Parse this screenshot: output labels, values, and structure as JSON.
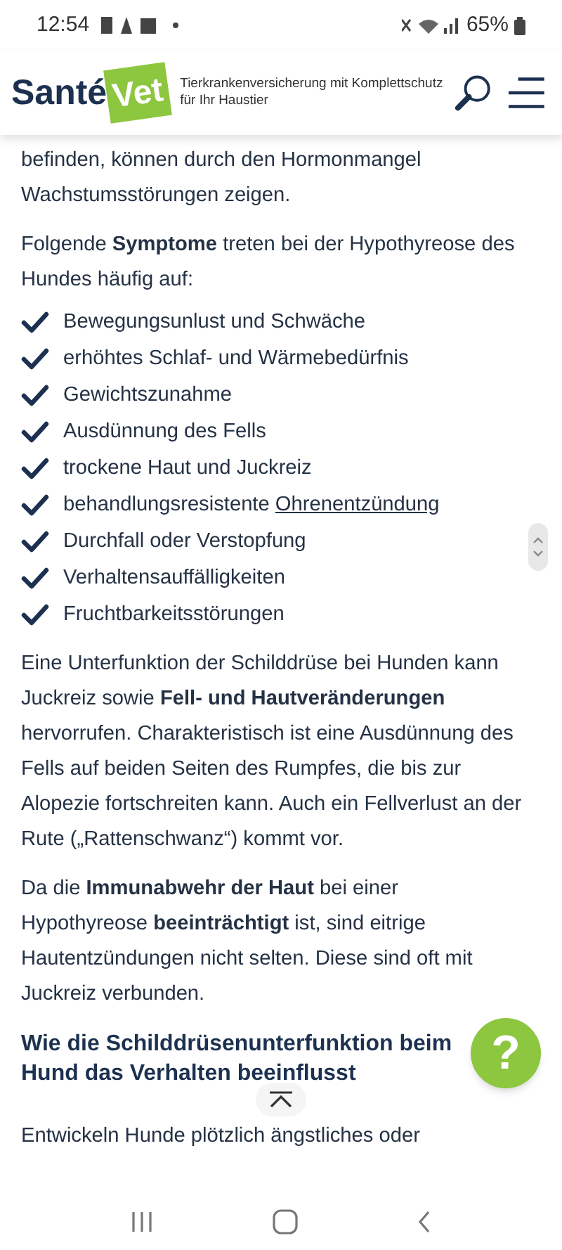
{
  "status_bar": {
    "time": "12:54",
    "battery": "65%"
  },
  "header": {
    "logo_left": "Santé",
    "logo_right": "Vet",
    "tagline": "Tierkrankenversicherung mit Komplettschutz für Ihr Haustier"
  },
  "intro": "befinden, können durch den Hormonmangel Wachstumsstörungen zeigen.",
  "symptoms_intro": "Folgende **Symptome** treten bei der Hypothyreose des Hundes häufig auf:",
  "symptoms": [
    {
      "text": "Bewegungsunlust und Schwäche"
    },
    {
      "text": "erhöhtes Schlaf- und Wärmebedürfnis"
    },
    {
      "text": "Gewichtszunahme"
    },
    {
      "text": "Ausdünnung des Fells"
    },
    {
      "text": "trockene Haut und Juckreiz"
    },
    {
      "text": "behandlungsresistente ",
      "link": "Ohrenentzündung"
    },
    {
      "text": "Durchfall oder Verstopfung"
    },
    {
      "text": "Verhaltensauffälligkeiten"
    },
    {
      "text": "Fruchtbarkeitsstörungen"
    }
  ],
  "paragraphs": [
    "Eine Unterfunktion der Schilddrüse bei Hunden kann Juckreiz sowie **Fell- und Hautveränderungen** hervorrufen. Charakteristisch ist eine Ausdünnung des Fells auf beiden Seiten des Rumpfes, die bis zur Alopezie fortschreiten kann. Auch ein Fellverlust an der Rute („Rattenschwanz“) kommt vor.",
    "Da die **Immunabwehr der Haut** bei einer Hypothyreose **beeinträchtigt** ist, sind eitrige Hautentzündungen nicht selten. Diese sind oft mit Juckreiz verbunden."
  ],
  "heading": "Wie die Schilddrüsenunterfunktion beim Hund das Verhalten beeinflusst",
  "last_line": "Entwickeln Hunde plötzlich ängstliches oder",
  "help_button": "?"
}
